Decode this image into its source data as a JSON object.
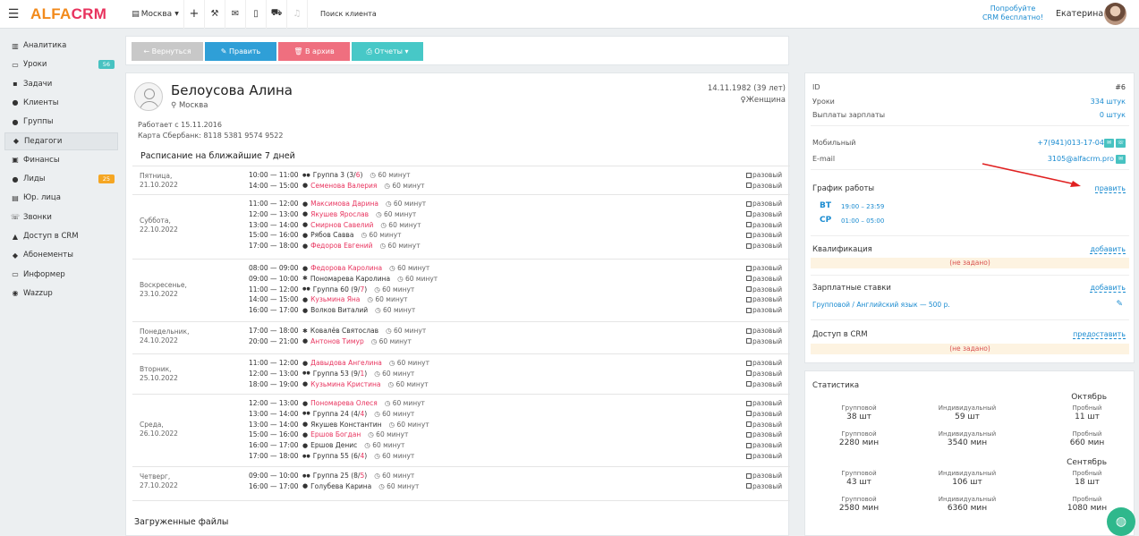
{
  "header": {
    "logo_a": "ALFA",
    "logo_b": "CRM",
    "city": "Москва",
    "search_placeholder": "Поиск клиента",
    "try_line1": "Попробуйте",
    "try_line2": "CRM бесплатно!",
    "user_name": "Екатерина"
  },
  "sidebar": {
    "items": [
      {
        "icon": "chart-icon",
        "glyph": "▥",
        "label": "Аналитика",
        "badge": ""
      },
      {
        "icon": "calendar-icon",
        "glyph": "▭",
        "label": "Уроки",
        "badge": "56",
        "badge_color": "#47c2c1"
      },
      {
        "icon": "tasks-icon",
        "glyph": "▪",
        "label": "Задачи",
        "badge": ""
      },
      {
        "icon": "user-icon",
        "glyph": "●",
        "label": "Клиенты",
        "badge": ""
      },
      {
        "icon": "users-icon",
        "glyph": "●",
        "label": "Группы",
        "badge": ""
      },
      {
        "icon": "graduation-cap-icon",
        "glyph": "◆",
        "label": "Педагоги",
        "badge": "",
        "active": true
      },
      {
        "icon": "money-icon",
        "glyph": "▣",
        "label": "Финансы",
        "badge": ""
      },
      {
        "icon": "lead-icon",
        "glyph": "●",
        "label": "Лиды",
        "badge": "25",
        "badge_color": "#f5a623"
      },
      {
        "icon": "building-icon",
        "glyph": "▤",
        "label": "Юр. лица",
        "badge": ""
      },
      {
        "icon": "phone-icon",
        "glyph": "☏",
        "label": "Звонки",
        "badge": ""
      },
      {
        "icon": "lock-icon",
        "glyph": "▲",
        "label": "Доступ в CRM",
        "badge": ""
      },
      {
        "icon": "tag-icon",
        "glyph": "◆",
        "label": "Абонементы",
        "badge": ""
      },
      {
        "icon": "monitor-icon",
        "glyph": "▭",
        "label": "Информер",
        "badge": ""
      },
      {
        "icon": "whatsapp-icon",
        "glyph": "◉",
        "label": "Wazzup",
        "badge": ""
      }
    ]
  },
  "actions": {
    "back": "← Вернуться",
    "edit": "✎ Править",
    "archive": "🗑 В архив",
    "reports": "⎙ Отчеты ▾"
  },
  "profile": {
    "name": "Белоусова Алина",
    "city": "Москва",
    "dob": "14.11.1982 (39 лет)",
    "gender": "Женщина",
    "works_since": "Работает с 15.11.2016",
    "card": "Карта Сбербанк: 8118 5381 9574 9522"
  },
  "schedule": {
    "title": "Расписание на ближайшие 7 дней",
    "once_label": "разовый",
    "days": [
      {
        "weekday": "Пятница,",
        "date": "21.10.2022",
        "lessons": [
          {
            "time": "10:00 — 11:00",
            "kind": "group",
            "name": "Группа 3",
            "count_a": "(3/",
            "count_b": "6",
            "count_c": ")",
            "dur": "60 минут"
          },
          {
            "time": "14:00 — 15:00",
            "kind": "indiv",
            "name": "Семенова Валерия",
            "dur": "60 минут"
          }
        ]
      },
      {
        "weekday": "Суббота,",
        "date": "22.10.2022",
        "lessons": [
          {
            "time": "11:00 — 12:00",
            "kind": "indiv",
            "name": "Максимова Дарина",
            "dur": "60 минут"
          },
          {
            "time": "12:00 — 13:00",
            "kind": "indiv",
            "name": "Якушев Ярослав",
            "dur": "60 минут"
          },
          {
            "time": "13:00 — 14:00",
            "kind": "indiv",
            "name": "Смирнов Савелий",
            "dur": "60 минут"
          },
          {
            "time": "15:00 — 16:00",
            "kind": "indiv-b",
            "name": "Рябов Савва",
            "dur": "60 минут"
          },
          {
            "time": "17:00 — 18:00",
            "kind": "indiv",
            "name": "Федоров Евгений",
            "dur": "60 минут"
          }
        ]
      },
      {
        "weekday": "Воскресенье,",
        "date": "23.10.2022",
        "lessons": [
          {
            "time": "08:00 — 09:00",
            "kind": "indiv",
            "name": "Федорова Каролина",
            "dur": "60 минут"
          },
          {
            "time": "09:00 — 10:00",
            "kind": "trial",
            "name": "Пономарева Каролина",
            "dur": "60 минут"
          },
          {
            "time": "11:00 — 12:00",
            "kind": "group",
            "name": "Группа 60",
            "count_a": "(9/",
            "count_b": "7",
            "count_c": ")",
            "dur": "60 минут"
          },
          {
            "time": "14:00 — 15:00",
            "kind": "indiv",
            "name": "Кузьмина Яна",
            "dur": "60 минут"
          },
          {
            "time": "16:00 — 17:00",
            "kind": "indiv-b",
            "name": "Волков Виталий",
            "dur": "60 минут"
          }
        ]
      },
      {
        "weekday": "Понедельник,",
        "date": "24.10.2022",
        "lessons": [
          {
            "time": "17:00 — 18:00",
            "kind": "trial",
            "name": "Ковалёв Святослав",
            "dur": "60 минут"
          },
          {
            "time": "20:00 — 21:00",
            "kind": "indiv",
            "name": "Антонов Тимур",
            "dur": "60 минут"
          }
        ]
      },
      {
        "weekday": "Вторник,",
        "date": "25.10.2022",
        "lessons": [
          {
            "time": "11:00 — 12:00",
            "kind": "indiv",
            "name": "Давыдова Ангелина",
            "dur": "60 минут"
          },
          {
            "time": "12:00 — 13:00",
            "kind": "group",
            "name": "Группа 53",
            "count_a": "(9/",
            "count_b": "1",
            "count_c": ")",
            "dur": "60 минут"
          },
          {
            "time": "18:00 — 19:00",
            "kind": "indiv",
            "name": "Кузьмина Кристина",
            "dur": "60 минут"
          }
        ]
      },
      {
        "weekday": "Среда,",
        "date": "26.10.2022",
        "lessons": [
          {
            "time": "12:00 — 13:00",
            "kind": "indiv",
            "name": "Пономарева Олеся",
            "dur": "60 минут"
          },
          {
            "time": "13:00 — 14:00",
            "kind": "group",
            "name": "Группа 24",
            "count_a": "(4/",
            "count_b": "4",
            "count_c": ")",
            "dur": "60 минут"
          },
          {
            "time": "13:00 — 14:00",
            "kind": "indiv-b",
            "name": "Якушев Константин",
            "dur": "60 минут"
          },
          {
            "time": "15:00 — 16:00",
            "kind": "indiv",
            "name": "Ершов Богдан",
            "dur": "60 минут"
          },
          {
            "time": "16:00 — 17:00",
            "kind": "indiv-b",
            "name": "Ершов Денис",
            "dur": "60 минут"
          },
          {
            "time": "17:00 — 18:00",
            "kind": "group",
            "name": "Группа 55",
            "count_a": "(6/",
            "count_b": "4",
            "count_c": ")",
            "dur": "60 минут"
          }
        ]
      },
      {
        "weekday": "Четверг,",
        "date": "27.10.2022",
        "lessons": [
          {
            "time": "09:00 — 10:00",
            "kind": "group",
            "name": "Группа 25",
            "count_a": "(8/",
            "count_b": "5",
            "count_c": ")",
            "dur": "60 минут"
          },
          {
            "time": "16:00 — 17:00",
            "kind": "indiv-b",
            "name": "Голубева Карина",
            "dur": "60 минут"
          }
        ]
      }
    ]
  },
  "files": {
    "title": "Загруженные файлы"
  },
  "info": {
    "id_label": "ID",
    "id_value": "#6",
    "lessons_label": "Уроки",
    "lessons_value": "334 штук",
    "salary_label": "Выплаты зарплаты",
    "salary_value": "0 штук",
    "mobile_label": "Мобильный",
    "mobile_value": "+7(941)013-17-04",
    "email_label": "E-mail",
    "email_value": "3105@alfacrm.pro",
    "schedule_title": "График работы",
    "edit_link": "править",
    "work": [
      {
        "day": "ВТ",
        "time": "19:00 – 23:59"
      },
      {
        "day": "СР",
        "time": "01:00 – 05:00"
      }
    ],
    "qual_title": "Квалификация",
    "add_link": "добавить",
    "unset": "(не задано)",
    "rates_title": "Зарплатные ставки",
    "rate_value": "Групповой / Английский язык",
    "rate_amount": "— 500 р.",
    "access_title": "Доступ в CRM",
    "grant_link": "предоставить"
  },
  "stats": {
    "title": "Статистика",
    "months": [
      {
        "name": "Октябрь",
        "rows": [
          [
            {
              "t": "Групповой",
              "v": "38 шт"
            },
            {
              "t": "Индивидуальный",
              "v": "59 шт"
            },
            {
              "t": "Пробный",
              "v": "11 шт"
            }
          ],
          [
            {
              "t": "Групповой",
              "v": "2280 мин"
            },
            {
              "t": "Индивидуальный",
              "v": "3540 мин"
            },
            {
              "t": "Пробный",
              "v": "660 мин"
            }
          ]
        ]
      },
      {
        "name": "Сентябрь",
        "rows": [
          [
            {
              "t": "Групповой",
              "v": "43 шт"
            },
            {
              "t": "Индивидуальный",
              "v": "106 шт"
            },
            {
              "t": "Пробный",
              "v": "18 шт"
            }
          ],
          [
            {
              "t": "Групповой",
              "v": "2580 мин"
            },
            {
              "t": "Индивидуальный",
              "v": "6360 мин"
            },
            {
              "t": "Пробный",
              "v": "1080 мин"
            }
          ]
        ]
      }
    ]
  },
  "colors": {
    "teal": "#47c2c1",
    "blue": "#1a8bd0",
    "red": "#e8335e",
    "orange": "#f28a1b",
    "gray_btn": "#c8c8c8",
    "archive": "#ef6f7f",
    "reports": "#47c8c7",
    "edit": "#2f9fd7"
  }
}
